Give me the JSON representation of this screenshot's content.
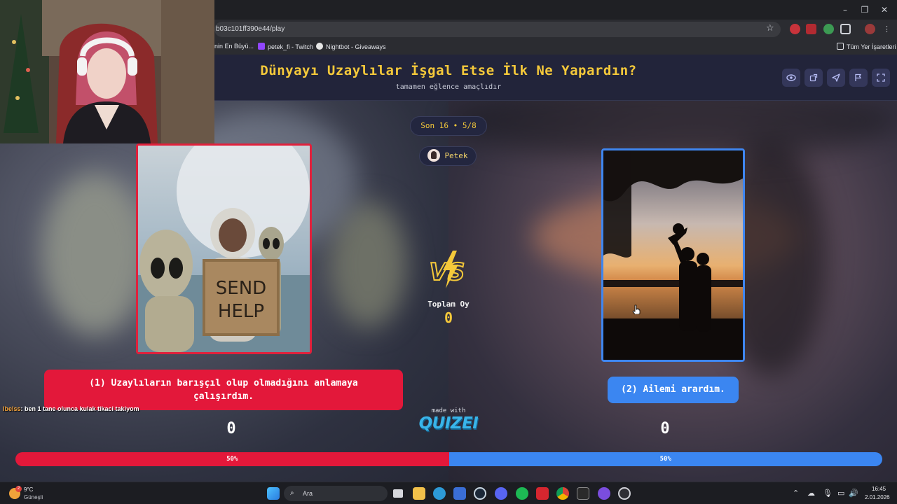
{
  "browser": {
    "url": "b03c101ff390e44/play",
    "bookmarks": [
      {
        "label": "nin En Büyü..."
      },
      {
        "label": "petek_fi - Twitch"
      },
      {
        "label": "Nightbot - Giveaways"
      }
    ],
    "all_bookmarks_label": "Tüm Yer İşaretleri",
    "window_controls": {
      "minimize": "–",
      "restore": "❐",
      "close": "✕"
    }
  },
  "quiz": {
    "title": "Dünyayı Uzaylılar İşgal Etse İlk Ne Yapardın?",
    "subtitle": "tamamen eğlence amaçlıdır",
    "round_label": "Son 16 • 5/8",
    "player_name": "Petek",
    "vs_label": "VS",
    "total_label": "Toplam Oy",
    "total_votes": "0",
    "options": [
      {
        "label": "(1) Uzaylıların barışçıl olup olmadığını anlamaya çalışırdım.",
        "votes": "0",
        "percent_label": "50%",
        "color": "#e3183a",
        "sign_text": "SEND HELP"
      },
      {
        "label": "(2) Ailemi arardım.",
        "votes": "0",
        "percent_label": "50%",
        "color": "#3b86f1"
      }
    ],
    "vote_share": 0.5,
    "made_with": "made with",
    "brand": "QUIZEI",
    "header_icons": [
      "eye-icon",
      "share-icon",
      "send-icon",
      "flag-icon",
      "fullscreen-icon"
    ]
  },
  "chat": {
    "user": "lbelss",
    "message": ": ben 1 tane olunca kulak tikaci takiyom"
  },
  "taskbar": {
    "weather_temp": "9°C",
    "weather_desc": "Güneşli",
    "weather_badge": "2",
    "search_placeholder": "Ara",
    "time": "16:45",
    "date": "2.01.2026"
  }
}
